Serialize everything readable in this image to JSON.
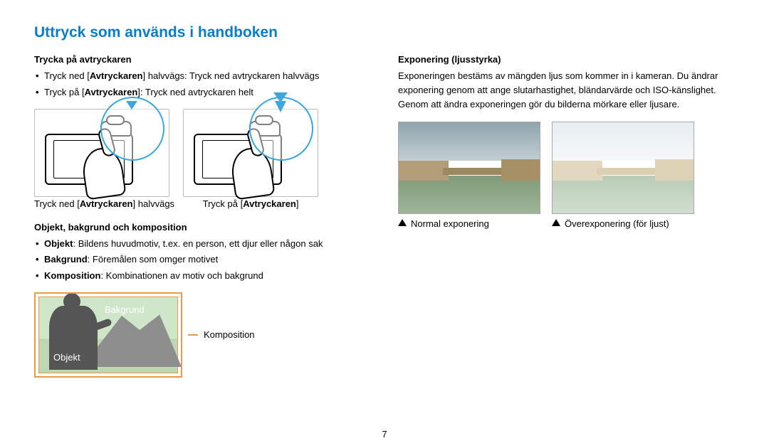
{
  "title": "Uttryck som används i handboken",
  "left": {
    "section1": {
      "heading": "Trycka på avtryckaren",
      "bullet1_pre": "Tryck ned [",
      "bullet1_bold": "Avtryckaren",
      "bullet1_post": "] halvvägs: Tryck ned avtryckaren halvvägs",
      "bullet2_pre": "Tryck på [",
      "bullet2_bold": "Avtryckaren",
      "bullet2_post": "]: Tryck ned avtryckaren helt",
      "caption1_pre": "Tryck ned [",
      "caption1_bold": "Avtryckaren",
      "caption1_post": "] halvvägs",
      "caption2_pre": "Tryck på [",
      "caption2_bold": "Avtryckaren",
      "caption2_post": "]"
    },
    "section2": {
      "heading": "Objekt, bakgrund och komposition",
      "obj_label": "Objekt",
      "obj_text": ": Bildens huvudmotiv, t.ex. en person, ett djur eller någon sak",
      "bak_label": "Bakgrund",
      "bak_text": ": Föremålen som omger motivet",
      "komp_label": "Komposition",
      "komp_text": ": Kombinationen av motiv och bakgrund",
      "diagram_bakgrund": "Bakgrund",
      "diagram_objekt": "Objekt",
      "diagram_komposition": "Komposition"
    }
  },
  "right": {
    "heading": "Exponering (ljusstyrka)",
    "paragraph": "Exponeringen bestäms av mängden ljus som kommer in i kameran. Du ändrar exponering genom att ange slutarhastighet, bländarvärde och ISO-känslighet. Genom att ändra exponeringen gör du bilderna mörkare eller ljusare.",
    "caption_normal": "Normal exponering",
    "caption_over": "Överexponering (för ljust)"
  },
  "page_number": "7"
}
